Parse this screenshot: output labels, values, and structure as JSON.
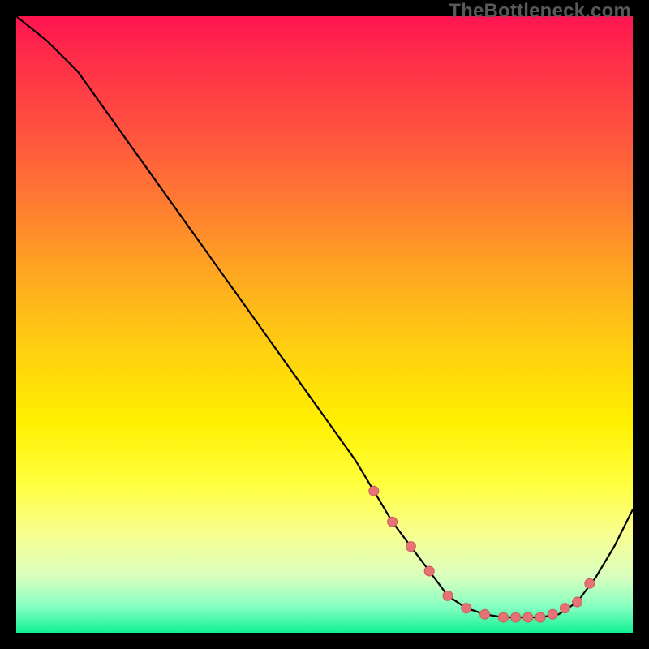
{
  "watermark": "TheBottleneck.com",
  "colors": {
    "curve_stroke": "#000000",
    "dot_fill": "#e57373",
    "dot_stroke": "#c95b5b"
  },
  "chart_data": {
    "type": "line",
    "title": "",
    "xlabel": "",
    "ylabel": "",
    "xlim": [
      0,
      100
    ],
    "ylim": [
      0,
      100
    ],
    "grid": false,
    "legend": false,
    "description": "Bottleneck-style curve descending steeply from top-left, flattening in a basin around x≈70–88, then rising toward the right edge. Points highlighted with dots along the basin.",
    "x": [
      0,
      5,
      10,
      15,
      20,
      25,
      30,
      35,
      40,
      45,
      50,
      55,
      58,
      61,
      64,
      67,
      70,
      73,
      76,
      79,
      82,
      85,
      88,
      91,
      94,
      97,
      100
    ],
    "values": [
      100,
      96,
      91,
      84,
      77,
      70,
      63,
      56,
      49,
      42,
      35,
      28,
      23,
      18,
      14,
      10,
      6,
      4,
      3,
      2.5,
      2.5,
      2.5,
      3,
      5,
      9,
      14,
      20
    ],
    "dots_x": [
      58,
      61,
      64,
      67,
      70,
      73,
      76,
      79,
      81,
      83,
      85,
      87,
      89,
      91,
      93
    ],
    "dots_y": [
      23,
      18,
      14,
      10,
      6,
      4,
      3,
      2.5,
      2.5,
      2.5,
      2.5,
      3,
      4,
      5,
      8
    ]
  }
}
